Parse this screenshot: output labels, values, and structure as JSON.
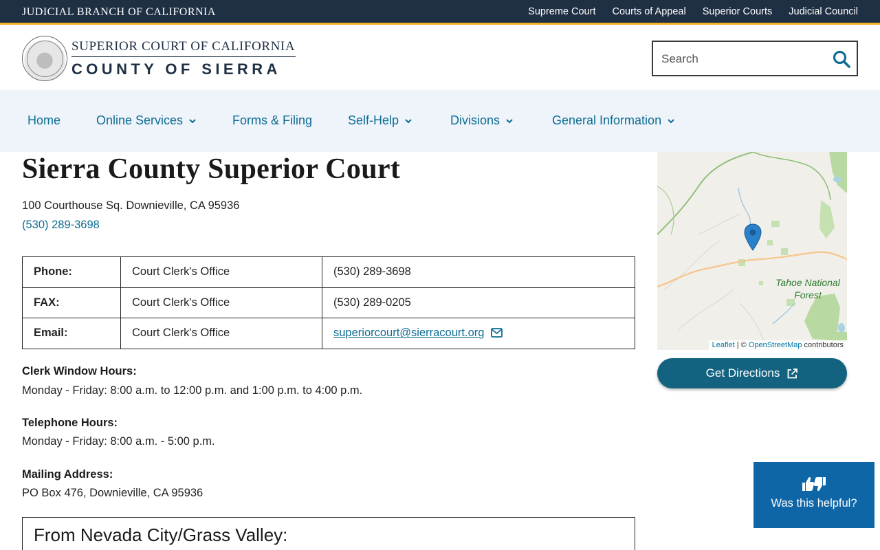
{
  "topbar": {
    "brand": "JUDICIAL BRANCH OF CALIFORNIA",
    "links": [
      "Supreme Court",
      "Courts of Appeal",
      "Superior Courts",
      "Judicial Council"
    ]
  },
  "header": {
    "court_title": "SUPERIOR COURT OF CALIFORNIA",
    "county_title": "COUNTY OF SIERRA",
    "search_placeholder": "Search"
  },
  "nav": {
    "items": [
      {
        "label": "Home"
      },
      {
        "label": "Online Services"
      },
      {
        "label": "Forms & Filing"
      },
      {
        "label": "Self-Help"
      },
      {
        "label": "Divisions"
      },
      {
        "label": "General Information"
      }
    ]
  },
  "main": {
    "title": "Sierra County Superior Court",
    "address": "100 Courthouse Sq. Downieville, CA 95936",
    "phone": "(530) 289-3698",
    "contacts": [
      {
        "label": "Phone:",
        "office": "Court Clerk's Office",
        "value": "(530) 289-3698"
      },
      {
        "label": "FAX:",
        "office": "Court Clerk's Office",
        "value": "(530) 289-0205"
      },
      {
        "label": "Email:",
        "office": "Court Clerk's Office",
        "value": "superiorcourt@sierracourt.org"
      }
    ],
    "clerk_hours_label": "Clerk Window Hours:",
    "clerk_hours": "Monday - Friday: 8:00 a.m. to 12:00 p.m. and 1:00 p.m. to 4:00 p.m.",
    "telephone_hours_label": "Telephone Hours:",
    "telephone_hours": "Monday - Friday: 8:00 a.m. - 5:00 p.m.",
    "mailing_label": "Mailing Address:",
    "mailing_address": "PO Box 476, Downieville, CA 95936",
    "directions_heading": "From Nevada City/Grass Valley:"
  },
  "map": {
    "place_label": "Tahoe National Forest",
    "attribution_leaflet": "Leaflet",
    "attribution_sep": " | © ",
    "attribution_osm": "OpenStreetMap",
    "attribution_rest": " contributors",
    "directions_label": "Get Directions"
  },
  "feedback": {
    "label": "Was this helpful?"
  },
  "colors": {
    "topbar": "#1f3044",
    "accent_gold": "#f0b323",
    "link": "#0e6c93",
    "nav_bg": "#eef4fa",
    "button": "#136380",
    "feedback": "#0f66a6"
  }
}
